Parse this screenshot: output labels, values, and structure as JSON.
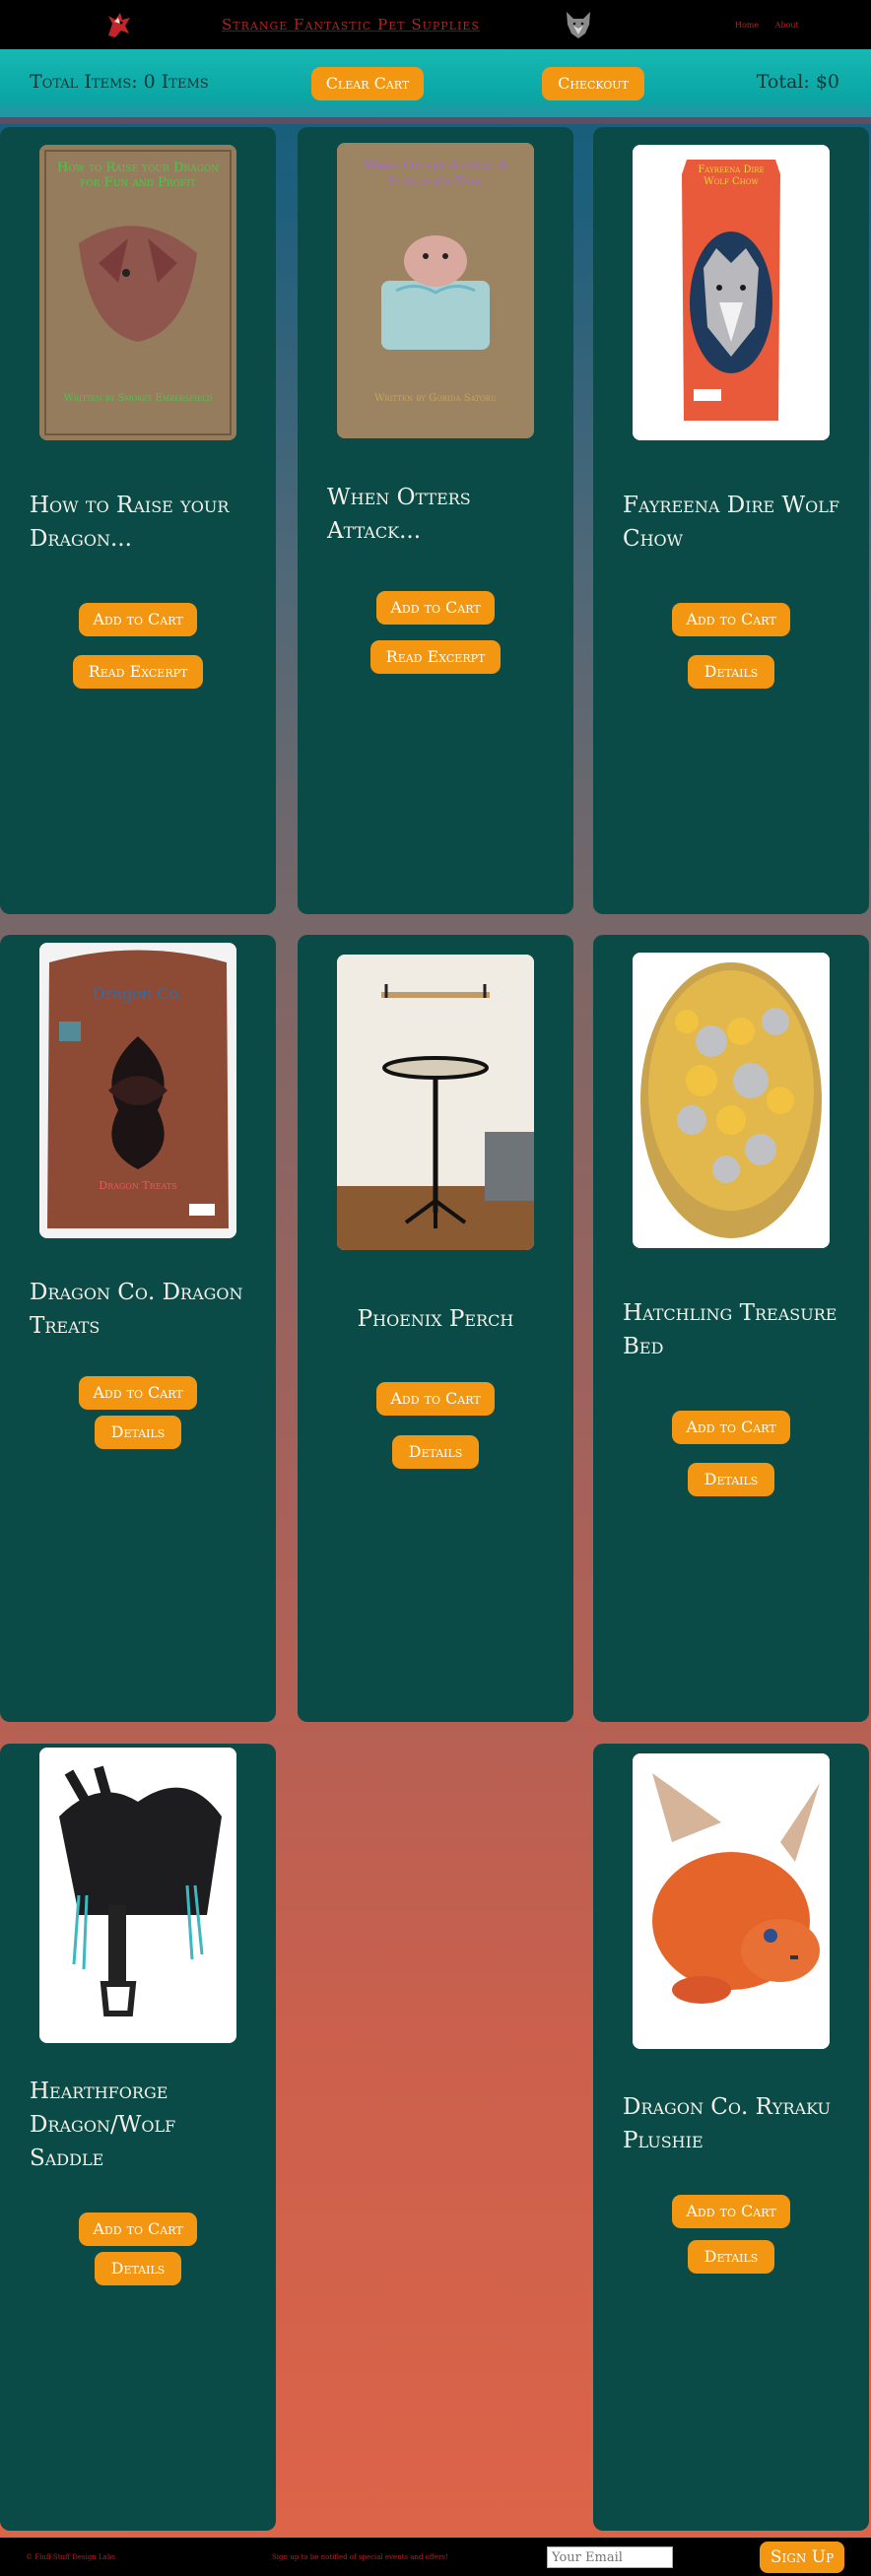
{
  "header": {
    "site_title": "Strange Fantastic Pet Supplies",
    "links": [
      "Home",
      "About"
    ]
  },
  "cart": {
    "total_items": "Total Items: 0 Items",
    "clear_label": "Clear Cart",
    "checkout_label": "Checkout",
    "total_price": "Total: $0"
  },
  "products": [
    {
      "name": "How to Raise your Dragon...",
      "add_label": "Add to Cart",
      "secondary_label": "Read Excerpt",
      "cover_title": "How to Raise your Dragon for Fun and Profit",
      "cover_author": "Written by Smokey Embersfield",
      "image_icon": "dragon-book-cover"
    },
    {
      "name": "When Otters Attack...",
      "add_label": "Add to Cart",
      "secondary_label": "Read Excerpt",
      "cover_title": "When Otters Attack: A Survivor's Tale",
      "cover_author": "Written by Gorida Satoru",
      "image_icon": "otter-book-cover"
    },
    {
      "name": "Fayreena Dire Wolf Chow",
      "add_label": "Add to Cart",
      "secondary_label": "Details",
      "bag_label": "Fayreena Dire Wolf Chow",
      "image_icon": "wolf-food-bag"
    },
    {
      "name": "Dragon Co. Dragon Treats",
      "add_label": "Add to Cart",
      "secondary_label": "Details",
      "bag_brand": "Dragon Co.",
      "bag_label": "Dragon Treats",
      "image_icon": "dragon-treat-bag"
    },
    {
      "name": "Phoenix Perch",
      "add_label": "Add to Cart",
      "secondary_label": "Details",
      "image_icon": "perch-stand"
    },
    {
      "name": "Hatchling Treasure Bed",
      "add_label": "Add to Cart",
      "secondary_label": "Details",
      "image_icon": "treasure-bed"
    },
    {
      "name": "Hearthforge Dragon/Wolf Saddle",
      "add_label": "Add to Cart",
      "secondary_label": "Details",
      "image_icon": "saddle"
    },
    {
      "name": "Dragon Co. Ryraku Plushie",
      "add_label": "Add to Cart",
      "secondary_label": "Details",
      "image_icon": "dragon-plush"
    }
  ],
  "footer": {
    "left_text": "© Fluff-Stuff Design Labs",
    "middle_text": "Sign up to be notified of special events and offers!",
    "email_placeholder": "Your Email",
    "signup_label": "Sign Up"
  },
  "colors": {
    "accent": "#f39612",
    "card": "#0a4b47",
    "cartbar": "#0aa6a5",
    "title_red": "#b2241e"
  }
}
